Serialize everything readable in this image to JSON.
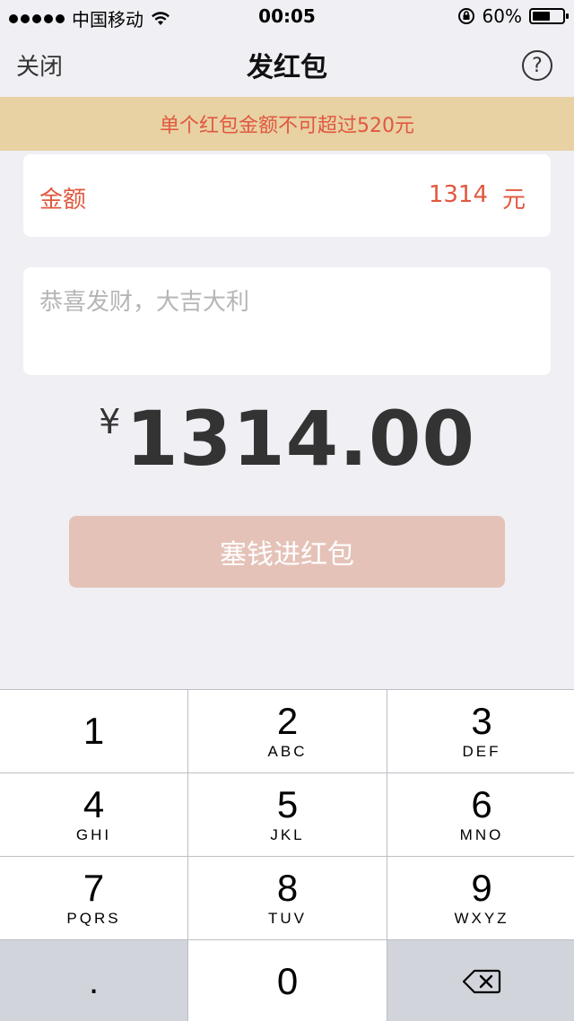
{
  "status_bar": {
    "carrier": "中国移动",
    "time": "00:05",
    "battery_percent": "60%",
    "battery_level": 0.6,
    "icons": [
      "signal-dots-icon",
      "wifi-icon",
      "orientation-lock-icon",
      "battery-icon"
    ]
  },
  "nav": {
    "close_label": "关闭",
    "title": "发红包",
    "help_label": "?"
  },
  "banner": {
    "text": "单个红包金额不可超过520元"
  },
  "amount": {
    "label": "金额",
    "value": "1314",
    "unit": "元"
  },
  "message": {
    "placeholder": "恭喜发财，大吉大利",
    "value": ""
  },
  "total": {
    "currency": "¥",
    "amount": "1314.00"
  },
  "submit": {
    "label": "塞钱进红包"
  },
  "keypad": {
    "keys": [
      {
        "digit": "1",
        "letters": ""
      },
      {
        "digit": "2",
        "letters": "ABC"
      },
      {
        "digit": "3",
        "letters": "DEF"
      },
      {
        "digit": "4",
        "letters": "GHI"
      },
      {
        "digit": "5",
        "letters": "JKL"
      },
      {
        "digit": "6",
        "letters": "MNO"
      },
      {
        "digit": "7",
        "letters": "PQRS"
      },
      {
        "digit": "8",
        "letters": "TUV"
      },
      {
        "digit": "9",
        "letters": "WXYZ"
      }
    ],
    "dot": ".",
    "zero": "0"
  },
  "colors": {
    "accent": "#e0583f",
    "banner_bg": "#e8d1a3",
    "button_bg": "#e5c2b8",
    "page_bg": "#efeff4"
  }
}
